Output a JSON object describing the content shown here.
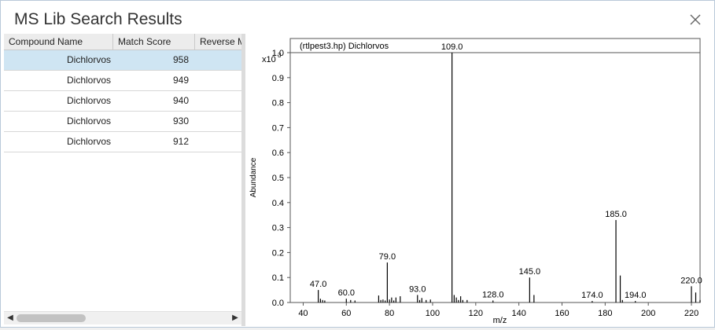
{
  "window": {
    "title": "MS Lib Search Results"
  },
  "table": {
    "columns": [
      "Compound Name",
      "Match Score",
      "Reverse M"
    ],
    "rows": [
      {
        "name": "Dichlorvos",
        "score": "958",
        "selected": true
      },
      {
        "name": "Dichlorvos",
        "score": "949"
      },
      {
        "name": "Dichlorvos",
        "score": "940"
      },
      {
        "name": "Dichlorvos",
        "score": "930"
      },
      {
        "name": "Dichlorvos",
        "score": "912"
      }
    ]
  },
  "scrollbar": {
    "left_arrow": "◀",
    "right_arrow": "▶"
  },
  "icons": {
    "close": "close-icon",
    "left": "chevron-left-icon",
    "right": "chevron-right-icon"
  },
  "colors": {
    "selected_row": "#cfe5f3",
    "peak": "#000000"
  },
  "chart_data": {
    "type": "bar",
    "title": "(rtlpest3.hp) Dichlorvos",
    "xlabel": "m/z",
    "ylabel": "Abundance",
    "y_multiplier": "x10",
    "y_exponent": "3",
    "xlim": [
      34,
      224
    ],
    "ylim": [
      0,
      1.0
    ],
    "xticks": [
      "40",
      "60",
      "80",
      "100",
      "120",
      "140",
      "160",
      "180",
      "200",
      "220"
    ],
    "yticks": [
      "0.0",
      "0.1",
      "0.2",
      "0.3",
      "0.4",
      "0.5",
      "0.6",
      "0.7",
      "0.8",
      "0.9",
      "1.0"
    ],
    "peaks": [
      {
        "mz": 47,
        "value": 0.05,
        "label": "47.0"
      },
      {
        "mz": 48,
        "value": 0.015
      },
      {
        "mz": 49,
        "value": 0.01
      },
      {
        "mz": 50,
        "value": 0.008
      },
      {
        "mz": 60,
        "value": 0.015,
        "label": "60.0"
      },
      {
        "mz": 62,
        "value": 0.01
      },
      {
        "mz": 64,
        "value": 0.008
      },
      {
        "mz": 75,
        "value": 0.028
      },
      {
        "mz": 76,
        "value": 0.01
      },
      {
        "mz": 77,
        "value": 0.012
      },
      {
        "mz": 78,
        "value": 0.008
      },
      {
        "mz": 79,
        "value": 0.16,
        "label": "79.0"
      },
      {
        "mz": 80,
        "value": 0.012
      },
      {
        "mz": 81,
        "value": 0.02
      },
      {
        "mz": 82,
        "value": 0.008
      },
      {
        "mz": 83,
        "value": 0.02
      },
      {
        "mz": 85,
        "value": 0.025
      },
      {
        "mz": 93,
        "value": 0.03,
        "label": "93.0"
      },
      {
        "mz": 94,
        "value": 0.01
      },
      {
        "mz": 95,
        "value": 0.018
      },
      {
        "mz": 97,
        "value": 0.01
      },
      {
        "mz": 99,
        "value": 0.012
      },
      {
        "mz": 109,
        "value": 1.0,
        "label": "109.0"
      },
      {
        "mz": 110,
        "value": 0.03
      },
      {
        "mz": 111,
        "value": 0.02
      },
      {
        "mz": 112,
        "value": 0.01
      },
      {
        "mz": 113,
        "value": 0.025
      },
      {
        "mz": 114,
        "value": 0.01
      },
      {
        "mz": 116,
        "value": 0.01
      },
      {
        "mz": 128,
        "value": 0.008,
        "label": "128.0"
      },
      {
        "mz": 145,
        "value": 0.1,
        "label": "145.0"
      },
      {
        "mz": 147,
        "value": 0.03
      },
      {
        "mz": 174,
        "value": 0.006,
        "label": "174.0"
      },
      {
        "mz": 185,
        "value": 0.33,
        "label": "185.0"
      },
      {
        "mz": 187,
        "value": 0.108
      },
      {
        "mz": 188,
        "value": 0.01
      },
      {
        "mz": 194,
        "value": 0.006,
        "label": "194.0"
      },
      {
        "mz": 220,
        "value": 0.065,
        "label": "220.0"
      },
      {
        "mz": 222,
        "value": 0.04
      },
      {
        "mz": 224,
        "value": 0.01
      }
    ]
  }
}
